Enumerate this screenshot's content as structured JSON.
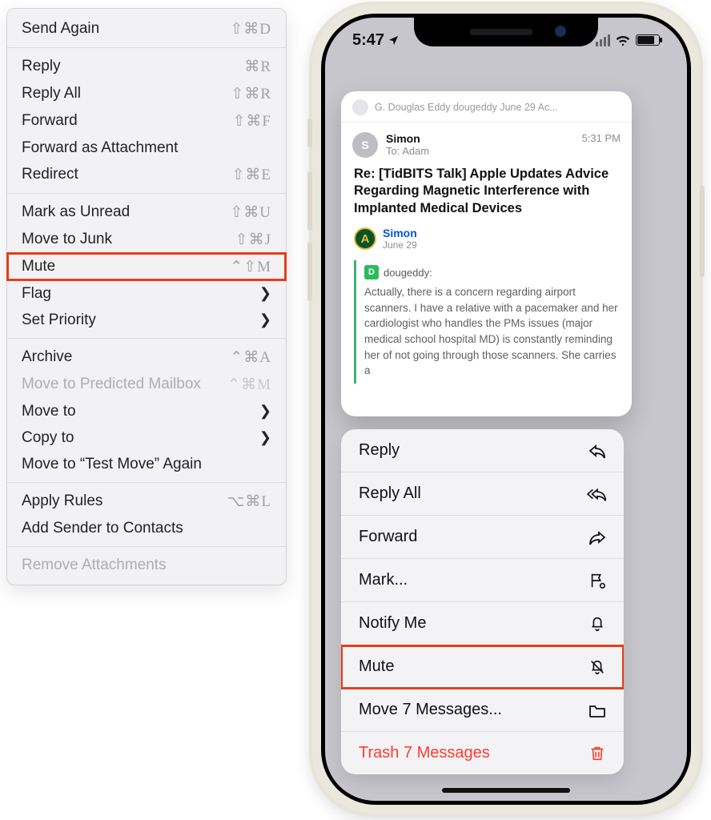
{
  "mac_menu": {
    "groups": [
      [
        {
          "label": "Send Again",
          "shortcut": "⇧⌘D",
          "enabled": true
        }
      ],
      [
        {
          "label": "Reply",
          "shortcut": "⌘R",
          "enabled": true
        },
        {
          "label": "Reply All",
          "shortcut": "⇧⌘R",
          "enabled": true
        },
        {
          "label": "Forward",
          "shortcut": "⇧⌘F",
          "enabled": true
        },
        {
          "label": "Forward as Attachment",
          "shortcut": "",
          "enabled": true
        },
        {
          "label": "Redirect",
          "shortcut": "⇧⌘E",
          "enabled": true
        }
      ],
      [
        {
          "label": "Mark as Unread",
          "shortcut": "⇧⌘U",
          "enabled": true
        },
        {
          "label": "Move to Junk",
          "shortcut": "⇧⌘J",
          "enabled": true
        },
        {
          "label": "Mute",
          "shortcut": "⌃⇧M",
          "enabled": true,
          "highlight": true
        },
        {
          "label": "Flag",
          "submenu": true,
          "enabled": true
        },
        {
          "label": "Set Priority",
          "submenu": true,
          "enabled": true
        }
      ],
      [
        {
          "label": "Archive",
          "shortcut": "⌃⌘A",
          "enabled": true
        },
        {
          "label": "Move to Predicted Mailbox",
          "shortcut": "⌃⌘M",
          "enabled": false
        },
        {
          "label": "Move to",
          "submenu": true,
          "enabled": true
        },
        {
          "label": "Copy to",
          "submenu": true,
          "enabled": true
        },
        {
          "label": "Move to “Test Move” Again",
          "shortcut": "",
          "enabled": true
        }
      ],
      [
        {
          "label": "Apply Rules",
          "shortcut": "⌥⌘L",
          "enabled": true
        },
        {
          "label": "Add Sender to Contacts",
          "shortcut": "",
          "enabled": true
        }
      ],
      [
        {
          "label": "Remove Attachments",
          "shortcut": "",
          "enabled": false
        }
      ]
    ]
  },
  "status": {
    "time": "5:47",
    "location_arrow": "↗"
  },
  "preview": {
    "top_line": "G. Douglas Eddy dougeddy June 29 Ac...",
    "sender": "Simon",
    "sender_initial": "S",
    "to_label": "To:",
    "to_name": "Adam",
    "time": "5:31 PM",
    "subject": "Re: [TidBITS Talk] Apple Updates Advice Regarding Magnetic Interference with Implanted Medical Devices",
    "inline_author": "Simon",
    "inline_date": "June 29",
    "quote_author_initial": "D",
    "quote_author": "dougeddy:",
    "quote_body": "Actually, there is a concern regarding airport scanners. I have a relative with a pacemaker and her cardiologist who handles the PMs issues (major medical school hospital MD) is constantly reminding her of not going through those scanners. She carries a"
  },
  "sheet": {
    "items": [
      {
        "label": "Reply",
        "icon": "reply"
      },
      {
        "label": "Reply All",
        "icon": "reply-all"
      },
      {
        "label": "Forward",
        "icon": "forward"
      },
      {
        "label": "Mark...",
        "icon": "flag"
      },
      {
        "label": "Notify Me",
        "icon": "bell"
      },
      {
        "label": "Mute",
        "icon": "bell-off",
        "highlight": true
      },
      {
        "label": "Move 7 Messages...",
        "icon": "folder"
      },
      {
        "label": "Trash 7 Messages",
        "icon": "trash",
        "destructive": true
      }
    ]
  }
}
